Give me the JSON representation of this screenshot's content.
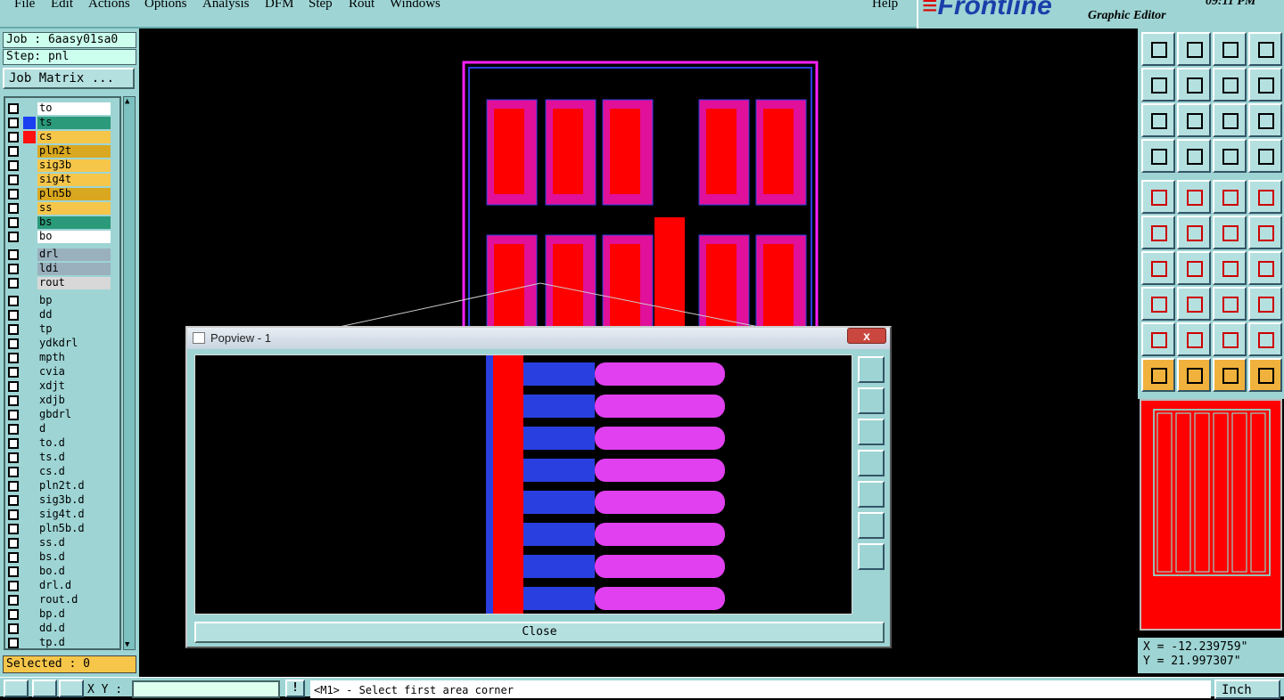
{
  "menu": [
    "File",
    "Edit",
    "Actions",
    "Options",
    "Analysis",
    "DFM",
    "Step",
    "Rout",
    "Windows"
  ],
  "help": "Help",
  "brand": {
    "logo": "Frontline",
    "subtitle": "Graphic Editor",
    "clock": "09:11 PM"
  },
  "job": {
    "job_label": "Job : 6aasy01sa0",
    "step_label": "Step: pnl",
    "matrix_button": "Job Matrix ..."
  },
  "layers": [
    {
      "name": "to",
      "color": "#ffffff",
      "swatch": ""
    },
    {
      "name": "ts",
      "color": "#2a9a7a",
      "swatch": "#1a3ff0"
    },
    {
      "name": "cs",
      "color": "#f5c64a",
      "swatch": "#ff1010"
    },
    {
      "name": "pln2t",
      "color": "#d9a820",
      "swatch": ""
    },
    {
      "name": "sig3b",
      "color": "#f5c64a",
      "swatch": ""
    },
    {
      "name": "sig4t",
      "color": "#f5c64a",
      "swatch": ""
    },
    {
      "name": "pln5b",
      "color": "#d9a820",
      "swatch": ""
    },
    {
      "name": "ss",
      "color": "#f5c64a",
      "swatch": ""
    },
    {
      "name": "bs",
      "color": "#2a9a7a",
      "swatch": ""
    },
    {
      "name": "bo",
      "color": "#ffffff",
      "swatch": ""
    },
    {
      "name": "drl",
      "color": "#9ab0bd",
      "swatch": ""
    },
    {
      "name": "ldi",
      "color": "#9ab0bd",
      "swatch": ""
    },
    {
      "name": "rout",
      "color": "#d8d8d8",
      "swatch": ""
    },
    {
      "name": "bp",
      "color": "#9ed4d4",
      "swatch": ""
    },
    {
      "name": "dd",
      "color": "#9ed4d4",
      "swatch": ""
    },
    {
      "name": "tp",
      "color": "#9ed4d4",
      "swatch": ""
    },
    {
      "name": "ydkdrl",
      "color": "#9ed4d4",
      "swatch": ""
    },
    {
      "name": "mpth",
      "color": "#9ed4d4",
      "swatch": ""
    },
    {
      "name": "cvia",
      "color": "#9ed4d4",
      "swatch": ""
    },
    {
      "name": "xdjt",
      "color": "#9ed4d4",
      "swatch": ""
    },
    {
      "name": "xdjb",
      "color": "#9ed4d4",
      "swatch": ""
    },
    {
      "name": "gbdrl",
      "color": "#9ed4d4",
      "swatch": ""
    },
    {
      "name": "d",
      "color": "#9ed4d4",
      "swatch": ""
    },
    {
      "name": "to.d",
      "color": "#9ed4d4",
      "swatch": ""
    },
    {
      "name": "ts.d",
      "color": "#9ed4d4",
      "swatch": ""
    },
    {
      "name": "cs.d",
      "color": "#9ed4d4",
      "swatch": ""
    },
    {
      "name": "pln2t.d",
      "color": "#9ed4d4",
      "swatch": ""
    },
    {
      "name": "sig3b.d",
      "color": "#9ed4d4",
      "swatch": ""
    },
    {
      "name": "sig4t.d",
      "color": "#9ed4d4",
      "swatch": ""
    },
    {
      "name": "pln5b.d",
      "color": "#9ed4d4",
      "swatch": ""
    },
    {
      "name": "ss.d",
      "color": "#9ed4d4",
      "swatch": ""
    },
    {
      "name": "bs.d",
      "color": "#9ed4d4",
      "swatch": ""
    },
    {
      "name": "bo.d",
      "color": "#9ed4d4",
      "swatch": ""
    },
    {
      "name": "drl.d",
      "color": "#9ed4d4",
      "swatch": ""
    },
    {
      "name": "rout.d",
      "color": "#9ed4d4",
      "swatch": ""
    },
    {
      "name": "bp.d",
      "color": "#9ed4d4",
      "swatch": ""
    },
    {
      "name": "dd.d",
      "color": "#9ed4d4",
      "swatch": ""
    },
    {
      "name": "tp.d",
      "color": "#9ed4d4",
      "swatch": ""
    }
  ],
  "selected_label": "Selected : 0",
  "popview": {
    "title": "Popview - 1",
    "close_x": "x",
    "close_button": "Close"
  },
  "coords": {
    "x": "X = -12.239759\"",
    "y": "Y = 21.997307\""
  },
  "bottom": {
    "xy_label": "X Y :",
    "xy_value": "",
    "bang": "!",
    "status": "<M1> - Select first area corner",
    "units": "Inch"
  }
}
